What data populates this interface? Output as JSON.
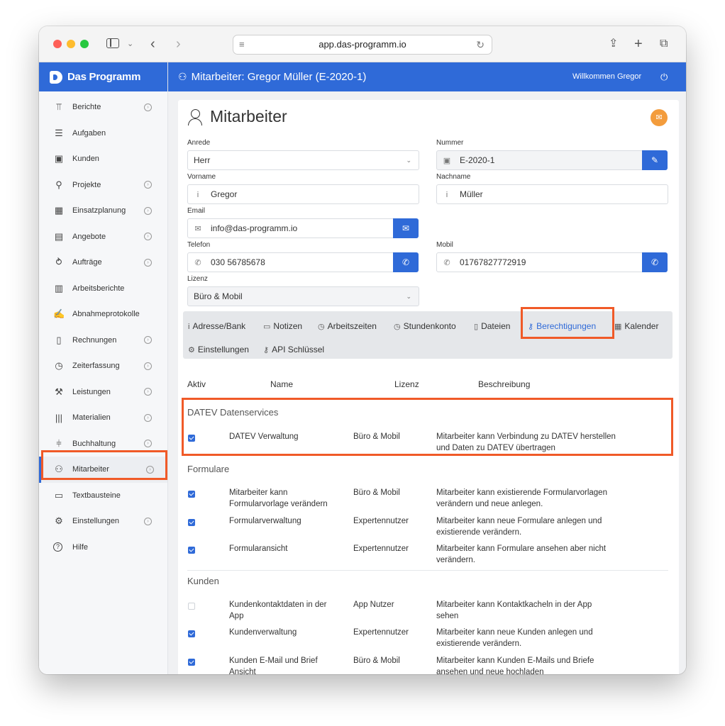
{
  "browser": {
    "url": "app.das-programm.io"
  },
  "sidebar": {
    "brand": "Das Programm",
    "items": [
      {
        "label": "Berichte",
        "icon": "bar-chart-icon",
        "chevron": true
      },
      {
        "label": "Aufgaben",
        "icon": "checklist-icon",
        "chevron": false
      },
      {
        "label": "Kunden",
        "icon": "contact-card-icon",
        "chevron": false
      },
      {
        "label": "Projekte",
        "icon": "project-tree-icon",
        "chevron": true
      },
      {
        "label": "Einsatzplanung",
        "icon": "calendar-icon",
        "chevron": true
      },
      {
        "label": "Angebote",
        "icon": "calculator-icon",
        "chevron": true
      },
      {
        "label": "Aufträge",
        "icon": "handshake-icon",
        "chevron": true
      },
      {
        "label": "Arbeitsberichte",
        "icon": "report-icon",
        "chevron": false
      },
      {
        "label": "Abnahmeprotokolle",
        "icon": "signature-icon",
        "chevron": false
      },
      {
        "label": "Rechnungen",
        "icon": "invoice-icon",
        "chevron": true
      },
      {
        "label": "Zeiterfassung",
        "icon": "clock-icon",
        "chevron": true
      },
      {
        "label": "Leistungen",
        "icon": "hammer-icon",
        "chevron": true
      },
      {
        "label": "Materialien",
        "icon": "barcode-icon",
        "chevron": true
      },
      {
        "label": "Buchhaltung",
        "icon": "ledger-icon",
        "chevron": true
      },
      {
        "label": "Mitarbeiter",
        "icon": "users-icon",
        "chevron": true
      },
      {
        "label": "Textbausteine",
        "icon": "text-block-icon",
        "chevron": false
      },
      {
        "label": "Einstellungen",
        "icon": "gears-icon",
        "chevron": true
      },
      {
        "label": "Hilfe",
        "icon": "help-icon",
        "chevron": false
      }
    ]
  },
  "header": {
    "title": "Mitarbeiter: Gregor Müller (E-2020-1)",
    "welcome": "Willkommen Gregor"
  },
  "page": {
    "title": "Mitarbeiter"
  },
  "form": {
    "anrede": {
      "label": "Anrede",
      "value": "Herr"
    },
    "nummer": {
      "label": "Nummer",
      "value": "E-2020-1"
    },
    "vorname": {
      "label": "Vorname",
      "value": "Gregor",
      "prefix": "i"
    },
    "nachname": {
      "label": "Nachname",
      "value": "Müller",
      "prefix": "i"
    },
    "email": {
      "label": "Email",
      "value": "info@das-programm.io"
    },
    "telefon": {
      "label": "Telefon",
      "value": "030 56785678"
    },
    "mobil": {
      "label": "Mobil",
      "value": "01767827772919"
    },
    "lizenz": {
      "label": "Lizenz",
      "value": "Büro & Mobil"
    }
  },
  "tabs": {
    "adresse": "Adresse/Bank",
    "notizen": "Notizen",
    "arbeitszeiten": "Arbeitszeiten",
    "stundenkonto": "Stundenkonto",
    "dateien": "Dateien",
    "berechtigungen": "Berechtigungen",
    "kalender": "Kalender",
    "einstellungen": "Einstellungen",
    "api": "API Schlüssel"
  },
  "permissions": {
    "columns": {
      "aktiv": "Aktiv",
      "name": "Name",
      "lizenz": "Lizenz",
      "beschreibung": "Beschreibung"
    },
    "sections": [
      {
        "title": "DATEV Datenservices",
        "rows": [
          {
            "checked": true,
            "name": [
              "DATEV Verwaltung"
            ],
            "license": "Büro & Mobil",
            "desc": [
              "Mitarbeiter kann Verbindung zu DATEV herstellen",
              "und Daten zu DATEV übertragen"
            ]
          }
        ]
      },
      {
        "title": "Formulare",
        "rows": [
          {
            "checked": true,
            "name": [
              "Mitarbeiter kann",
              "Formularvorlage verändern"
            ],
            "license": "Büro & Mobil",
            "desc": [
              "Mitarbeiter kann existierende Formularvorlagen",
              "verändern und neue anlegen."
            ]
          },
          {
            "checked": true,
            "name": [
              "Formularverwaltung"
            ],
            "license": "Expertennutzer",
            "desc": [
              "Mitarbeiter kann neue Formulare anlegen und",
              "existierende verändern."
            ]
          },
          {
            "checked": true,
            "name": [
              "Formularansicht"
            ],
            "license": "Expertennutzer",
            "desc": [
              "Mitarbeiter kann Formulare ansehen aber nicht",
              "verändern."
            ]
          }
        ]
      },
      {
        "title": "Kunden",
        "rows": [
          {
            "checked": false,
            "name": [
              "Kundenkontaktdaten in der",
              "App"
            ],
            "license": "App Nutzer",
            "desc": [
              "Mitarbeiter kann Kontaktkacheln in der App",
              "sehen"
            ]
          },
          {
            "checked": true,
            "name": [
              "Kundenverwaltung"
            ],
            "license": "Expertennutzer",
            "desc": [
              "Mitarbeiter kann neue Kunden anlegen und",
              "existierende verändern."
            ]
          },
          {
            "checked": true,
            "name": [
              "Kunden E-Mail und Brief",
              "Ansicht"
            ],
            "license": "Büro & Mobil",
            "desc": [
              "Mitarbeiter kann Kunden E-Mails und Briefe",
              "ansehen und neue hochladen"
            ]
          }
        ]
      }
    ]
  }
}
